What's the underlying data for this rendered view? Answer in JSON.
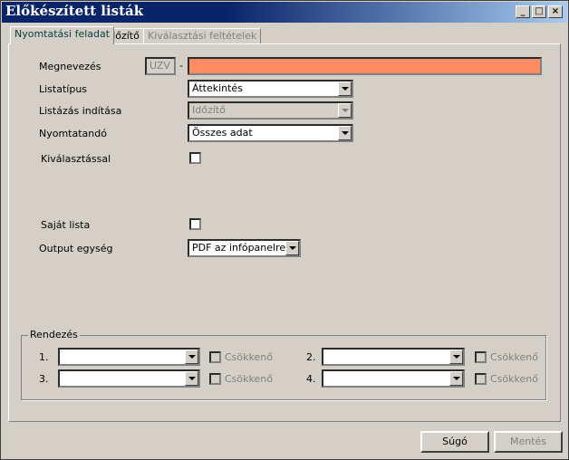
{
  "window": {
    "title": "Előkészített listák"
  },
  "tabs": [
    {
      "label": "Nyomtatási feladat"
    },
    {
      "label": "Időzítő"
    },
    {
      "label": "Kiválasztási feltételek"
    }
  ],
  "form": {
    "megnevezes": {
      "label": "Megnevezés",
      "prefix": "UZV",
      "separator": "-",
      "value": "",
      "highlight": "#ff8c64"
    },
    "listatipus": {
      "label": "Listatípus",
      "value": "Áttekintés"
    },
    "listazas": {
      "label": "Listázás indítása",
      "value": "Időzítő"
    },
    "nyomtatando": {
      "label": "Nyomtatandó",
      "value": "Összes adat"
    },
    "kivalasztassal": {
      "label": "Kiválasztással",
      "checked": false
    },
    "sajat_lista": {
      "label": "Saját lista",
      "checked": false
    },
    "output": {
      "label": "Output egység",
      "value": "PDF az infópanelre"
    }
  },
  "sorting": {
    "title": "Rendezés",
    "rows": [
      {
        "num": "1.",
        "value": "",
        "desc_label": "Csökkenő"
      },
      {
        "num": "2.",
        "value": "",
        "desc_label": "Csökkenő"
      },
      {
        "num": "3.",
        "value": "",
        "desc_label": "Csökkenő"
      },
      {
        "num": "4.",
        "value": "",
        "desc_label": "Csökkenő"
      }
    ]
  },
  "buttons": {
    "help": "Súgó",
    "save": "Mentés"
  }
}
